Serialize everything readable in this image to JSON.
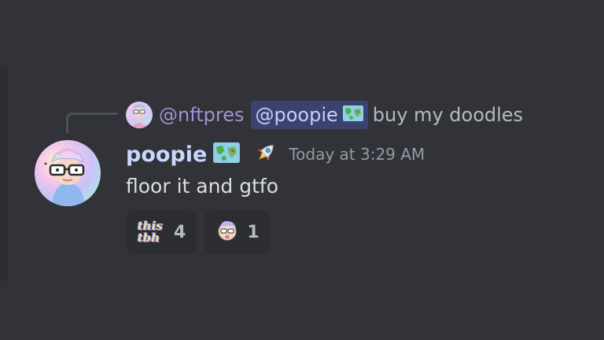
{
  "reply": {
    "author": "@nftpres",
    "mention": "@poopie",
    "text": "buy my doodles"
  },
  "message": {
    "username": "poopie",
    "timestamp": "Today at 3:29 AM",
    "content": "floor it and gtfo"
  },
  "reactions": [
    {
      "emoji": "this-tbh-emoji",
      "line1": "this",
      "line2": "tbh",
      "count": "4"
    },
    {
      "emoji": "doodle-face-emoji",
      "count": "1"
    }
  ],
  "colors": {
    "background": "#313338",
    "username": "#c9d6ff",
    "mention_bg": "#3c4270",
    "reply_author": "#a48fd4",
    "reaction_bg": "#2b2d31"
  },
  "icons": [
    "map-flag-icon",
    "rocket-icon"
  ]
}
